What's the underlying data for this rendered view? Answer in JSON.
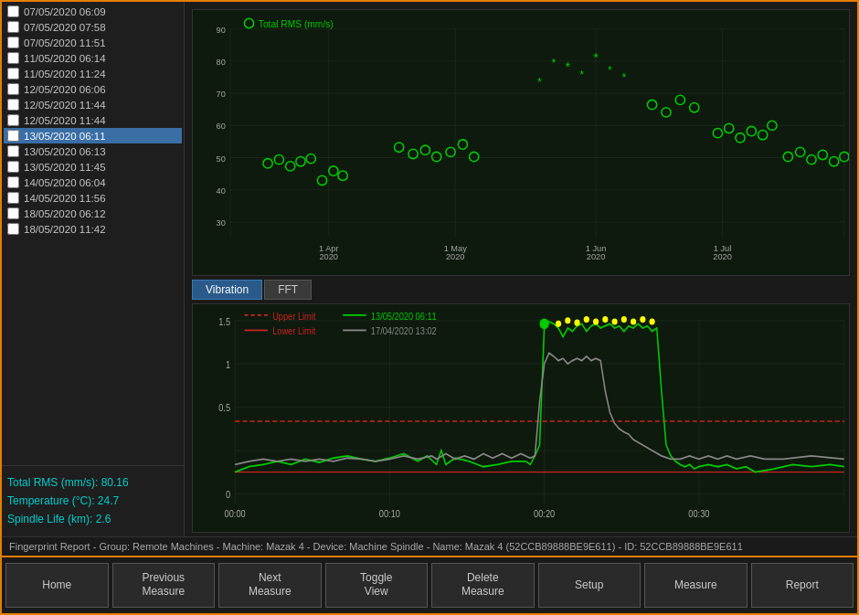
{
  "title": "Fingerprint Report",
  "status_bar": "Fingerprint Report - Group: Remote Machines - Machine: Mazak 4 - Device: Machine Spindle - Name: Mazak 4 (52CCB89888BE9E611) - ID: 52CCB89888BE9E611",
  "dates": [
    {
      "label": "07/05/2020 06:09",
      "checked": false,
      "selected": false
    },
    {
      "label": "07/05/2020 07:58",
      "checked": false,
      "selected": false
    },
    {
      "label": "07/05/2020 11:51",
      "checked": false,
      "selected": false
    },
    {
      "label": "11/05/2020 06:14",
      "checked": false,
      "selected": false
    },
    {
      "label": "11/05/2020 11:24",
      "checked": false,
      "selected": false
    },
    {
      "label": "12/05/2020 06:06",
      "checked": false,
      "selected": false
    },
    {
      "label": "12/05/2020 11:44",
      "checked": false,
      "selected": false
    },
    {
      "label": "12/05/2020 11:44",
      "checked": false,
      "selected": false
    },
    {
      "label": "13/05/2020 06:11",
      "checked": false,
      "selected": true
    },
    {
      "label": "13/05/2020 06:13",
      "checked": false,
      "selected": false
    },
    {
      "label": "13/05/2020 11:45",
      "checked": false,
      "selected": false
    },
    {
      "label": "14/05/2020 06:04",
      "checked": false,
      "selected": false
    },
    {
      "label": "14/05/2020 11:56",
      "checked": false,
      "selected": false
    },
    {
      "label": "18/05/2020 06:12",
      "checked": false,
      "selected": false
    },
    {
      "label": "18/05/2020 11:42",
      "checked": false,
      "selected": false
    }
  ],
  "stats": {
    "rms_label": "Total RMS (mm/s): 80.16",
    "temp_label": "Temperature (°C): 24.7",
    "spindle_label": "Spindle Life (km): 2.6"
  },
  "scatter": {
    "title": "Total RMS (mm/s)",
    "y_labels": [
      "90",
      "80",
      "70",
      "60",
      "50",
      "40",
      "30"
    ],
    "x_labels": [
      {
        "text": "1 Apr\n2020",
        "pct": 15
      },
      {
        "text": "1 May\n2020",
        "pct": 38
      },
      {
        "text": "1 Jun\n2020",
        "pct": 63
      },
      {
        "text": "1 Jul\n2020",
        "pct": 87
      }
    ]
  },
  "vibration": {
    "tabs": [
      "Vibration",
      "FFT"
    ],
    "active_tab": "Vibration",
    "legend": [
      {
        "color": "#cc2222",
        "dash": true,
        "label": "Upper Limit"
      },
      {
        "color": "#cc2222",
        "label": "Lower Limit"
      },
      {
        "color": "#00cc00",
        "label": "13/05/2020 06:11"
      },
      {
        "color": "#888888",
        "label": "17/04/2020 13:02"
      }
    ],
    "y_labels": [
      "1.5",
      "1",
      "0.5",
      "0"
    ],
    "x_labels": [
      "00:00",
      "00:10",
      "00:20",
      "00:30"
    ]
  },
  "toolbar": {
    "buttons": [
      {
        "label": "Home",
        "name": "home-button"
      },
      {
        "label": "Previous\nMeasure",
        "name": "previous-measure-button"
      },
      {
        "label": "Next\nMeasure",
        "name": "next-measure-button"
      },
      {
        "label": "Toggle\nView",
        "name": "toggle-view-button"
      },
      {
        "label": "Delete\nMeasure",
        "name": "delete-measure-button"
      },
      {
        "label": "Setup",
        "name": "setup-button"
      },
      {
        "label": "Measure",
        "name": "measure-button"
      },
      {
        "label": "Report",
        "name": "report-button"
      }
    ]
  }
}
